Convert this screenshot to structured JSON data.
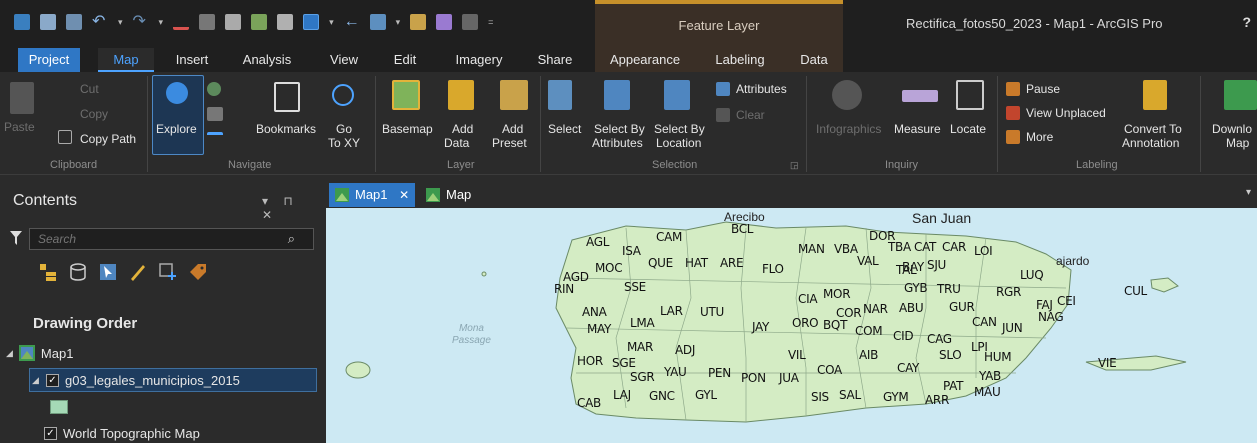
{
  "title_bar": {
    "contextual_group": "Feature Layer",
    "document_title": "Rectifica_fotos50_2023 - Map1 - ArcGIS Pro",
    "help": "?"
  },
  "ribbon_tabs": [
    "Project",
    "Map",
    "Insert",
    "Analysis",
    "View",
    "Edit",
    "Imagery",
    "Share",
    "Appearance",
    "Labeling",
    "Data"
  ],
  "ribbon": {
    "clipboard": {
      "paste": "Paste",
      "cut": "Cut",
      "copy": "Copy",
      "copy_path": "Copy Path",
      "group": "Clipboard"
    },
    "navigate": {
      "explore": "Explore",
      "bookmarks": "Bookmarks",
      "go": "Go",
      "to_xy": "To XY",
      "group": "Navigate"
    },
    "layer": {
      "basemap": "Basemap",
      "add": "Add",
      "data": "Data",
      "add2": "Add",
      "preset": "Preset",
      "group": "Layer"
    },
    "selection": {
      "select": "Select",
      "by_attr1": "Select By",
      "by_attr2": "Attributes",
      "by_loc1": "Select By",
      "by_loc2": "Location",
      "attributes": "Attributes",
      "clear": "Clear",
      "group": "Selection"
    },
    "inquiry": {
      "infographics": "Infographics",
      "measure": "Measure",
      "locate": "Locate",
      "group": "Inquiry"
    },
    "labeling": {
      "pause": "Pause",
      "view_unplaced": "View Unplaced",
      "more": "More",
      "convert1": "Convert To",
      "convert2": "Annotation",
      "group": "Labeling"
    },
    "download": {
      "line1": "Downlo",
      "line2": "Map"
    }
  },
  "contents": {
    "title": "Contents",
    "pane_controls": "▾ ⊓ ✕",
    "search_placeholder": "Search",
    "section": "Drawing Order",
    "tree": [
      {
        "label": "Map1"
      },
      {
        "label": "g03_legales_municipios_2015"
      },
      {
        "label": "World Topographic Map"
      }
    ]
  },
  "map_tabs": [
    {
      "label": "Map1",
      "close": "✕"
    },
    {
      "label": "Map"
    }
  ],
  "map": {
    "passage": "Mona\nPassage",
    "cities": [
      "San Juan",
      "Arecibo",
      "ajardo"
    ],
    "municipalities": [
      "AGL",
      "ISA",
      "CAM",
      "BCL",
      "DOR",
      "TBA",
      "CAT",
      "CAR",
      "LOI",
      "MAN",
      "VBA",
      "SJU",
      "BAY",
      "VAL",
      "TAL",
      "GYB",
      "TRU",
      "RGR",
      "LUQ",
      "FAJ",
      "CEI",
      "CUL",
      "AGD",
      "MOC",
      "QUE",
      "HAT",
      "ARE",
      "FLO",
      "RIN",
      "SSE",
      "CIA",
      "MOR",
      "COR",
      "NAR",
      "ABU",
      "GUR",
      "CAN",
      "JUN",
      "NAG",
      "ANA",
      "LAR",
      "UTU",
      "MAY",
      "LMA",
      "JAY",
      "ORO",
      "BQT",
      "COM",
      "CID",
      "CAG",
      "LPI",
      "MAR",
      "ADJ",
      "HOR",
      "SGE",
      "VIL",
      "AIB",
      "SLO",
      "HUM",
      "YAU",
      "PEN",
      "COA",
      "CAY",
      "SGR",
      "PON",
      "JUA",
      "YAB",
      "LAJ",
      "GNC",
      "GYL",
      "SIS",
      "SAL",
      "GYM",
      "ARR",
      "PAT",
      "MAU",
      "CAB",
      "VIE"
    ]
  }
}
